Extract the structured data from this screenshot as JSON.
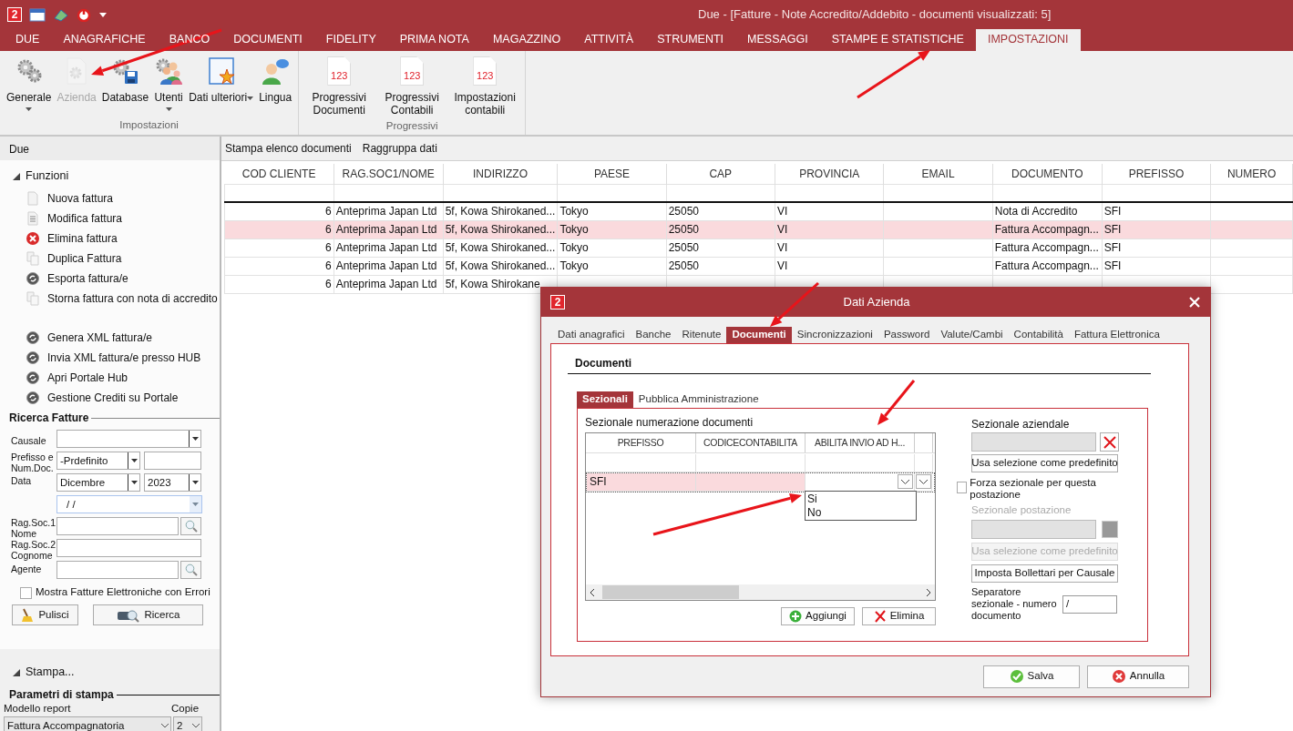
{
  "window": {
    "logo": "2",
    "title": "Due - [Fatture - Note Accredito/Addebito - documenti visualizzati: 5]"
  },
  "ribbon_tabs": [
    {
      "label": "DUE",
      "selected": false
    },
    {
      "label": "ANAGRAFICHE",
      "selected": false
    },
    {
      "label": "BANCO",
      "selected": false
    },
    {
      "label": "DOCUMENTI",
      "selected": false
    },
    {
      "label": "FIDELITY",
      "selected": false
    },
    {
      "label": "PRIMA NOTA",
      "selected": false
    },
    {
      "label": "MAGAZZINO",
      "selected": false
    },
    {
      "label": "ATTIVITÀ",
      "selected": false
    },
    {
      "label": "STRUMENTI",
      "selected": false
    },
    {
      "label": "MESSAGGI",
      "selected": false
    },
    {
      "label": "STAMPE E STATISTICHE",
      "selected": false
    },
    {
      "label": "IMPOSTAZIONI",
      "selected": true
    }
  ],
  "ribbon_groups": [
    {
      "label": "Impostazioni",
      "buttons": [
        {
          "label": "Generale",
          "dropdown": true,
          "caret_inline": false,
          "disabled": false
        },
        {
          "label": "Azienda",
          "disabled": true
        },
        {
          "label": "Database",
          "disabled": false
        },
        {
          "label": "Utenti",
          "dropdown": true,
          "caret_inline": false,
          "disabled": false
        },
        {
          "label": "Dati ulteriori",
          "dropdown": true,
          "caret_inline": true,
          "disabled": false
        },
        {
          "label": "Lingua",
          "disabled": false
        }
      ]
    },
    {
      "label": "Progressivi",
      "buttons": [
        {
          "label": "Progressivi Documenti",
          "badge": "123",
          "disabled": false
        },
        {
          "label": "Progressivi Contabili",
          "badge": "123",
          "disabled": false
        },
        {
          "label": "Impostazioni contabili",
          "badge": "123",
          "disabled": false
        }
      ]
    }
  ],
  "sidebar": {
    "title": "Due",
    "functions": {
      "label": "Funzioni",
      "expanded": true,
      "groups": [
        [
          {
            "label": "Nuova fattura"
          },
          {
            "label": "Modifica fattura"
          },
          {
            "label": "Elimina fattura"
          },
          {
            "label": "Duplica Fattura"
          },
          {
            "label": "Esporta fattura/e"
          },
          {
            "label": "Storna fattura con nota di accredito"
          }
        ],
        [
          {
            "label": "Genera XML fattura/e"
          },
          {
            "label": "Invia XML fattura/e presso HUB"
          },
          {
            "label": "Apri Portale Hub"
          },
          {
            "label": "Gestione Crediti su Portale"
          }
        ]
      ]
    }
  },
  "search": {
    "legend": "Ricerca Fatture",
    "causale_label": "Causale",
    "prefisso_label": "Prefisso e Num.Doc.",
    "prefisso_value": "-Prdefinito",
    "data_label": "Data",
    "month_value": "Dicembre",
    "year_value": "2023",
    "date_value": "/ /",
    "ragsoc1_label": "Rag.Soc.1 Nome",
    "ragsoc2_label": "Rag.Soc.2 Cognome",
    "agente_label": "Agente",
    "errors_checkbox": {
      "label": "Mostra Fatture Elettroniche con Errori",
      "checked": false
    },
    "buttons": [
      "Pulisci",
      "Ricerca"
    ]
  },
  "print": {
    "label": "Stampa...",
    "expanded": true,
    "legend": "Parametri di stampa",
    "model_label": "Modello report",
    "copies_label": "Copie",
    "model_value": "Fattura Accompagnatoria",
    "copies_value": "2"
  },
  "toolbar": [
    "Stampa elenco documenti",
    "Raggruppa dati"
  ],
  "table": {
    "columns": [
      "COD CLIENTE",
      "RAG.SOC1/NOME",
      "INDIRIZZO",
      "PAESE",
      "CAP",
      "PROVINCIA",
      "EMAIL",
      "DOCUMENTO",
      "PREFISSO",
      "NUMERO"
    ],
    "rows": [
      {
        "selected": false,
        "cells": [
          "6",
          "Anteprima Japan Ltd",
          "5f, Kowa Shirokaned...",
          "Tokyo",
          "25050",
          "VI",
          "",
          "Nota di Accredito",
          "SFI"
        ]
      },
      {
        "selected": true,
        "cells": [
          "6",
          "Anteprima Japan Ltd",
          "5f, Kowa Shirokaned...",
          "Tokyo",
          "25050",
          "VI",
          "",
          "Fattura Accompagn...",
          "SFI"
        ]
      },
      {
        "selected": false,
        "cells": [
          "6",
          "Anteprima Japan Ltd",
          "5f, Kowa Shirokaned...",
          "Tokyo",
          "25050",
          "VI",
          "",
          "Fattura Accompagn...",
          "SFI"
        ]
      },
      {
        "selected": false,
        "cells": [
          "6",
          "Anteprima Japan Ltd",
          "5f, Kowa Shirokaned...",
          "Tokyo",
          "25050",
          "VI",
          "",
          "Fattura Accompagn...",
          "SFI"
        ]
      },
      {
        "selected": false,
        "cells": [
          "6",
          "Anteprima Japan Ltd",
          "5f, Kowa Shirokane"
        ]
      }
    ]
  },
  "dialog": {
    "logo": "2",
    "title": "Dati Azienda",
    "tabs": [
      {
        "label": "Dati anagrafici",
        "selected": false
      },
      {
        "label": "Banche",
        "selected": false
      },
      {
        "label": "Ritenute",
        "selected": false
      },
      {
        "label": "Documenti",
        "selected": true
      },
      {
        "label": "Sincronizzazioni",
        "selected": false
      },
      {
        "label": "Password",
        "selected": false
      },
      {
        "label": "Valute/Cambi",
        "selected": false
      },
      {
        "label": "Contabilità",
        "selected": false
      },
      {
        "label": "Fattura Elettronica",
        "selected": false
      }
    ],
    "section_title": "Documenti",
    "subtabs": [
      {
        "label": "Sezionali",
        "selected": true
      },
      {
        "label": "Pubblica Amministrazione",
        "selected": false
      }
    ],
    "grid_label": "Sezionale numerazione documenti",
    "grid": {
      "columns": [
        "PREFISSO",
        "CODICECONTABILITA",
        "ABILITA INVIO AD H..."
      ],
      "rows": [
        {
          "selected": true,
          "cells": [
            "SFI"
          ]
        }
      ]
    },
    "dropdown": {
      "expanded": true,
      "options": [
        "Si",
        "No"
      ]
    },
    "grid_buttons": [
      "Aggiungi",
      "Elimina"
    ],
    "sezionale_label": "Sezionale aziendale",
    "default_button": {
      "label": "Usa selezione come predefinito",
      "disabled": false
    },
    "force_checkbox": {
      "label": "Forza sezionale per questa postazione",
      "checked": false
    },
    "postazione": {
      "label": "Sezionale postazione",
      "disabled": true
    },
    "postazione_default": {
      "label": "Usa selezione come predefinito",
      "disabled": true
    },
    "bollettari_button": "Imposta Bollettari per Causale",
    "separator_label": "Separatore sezionale - numero documento",
    "separator_value": "/",
    "footer_buttons": [
      "Salva",
      "Annulla"
    ]
  }
}
